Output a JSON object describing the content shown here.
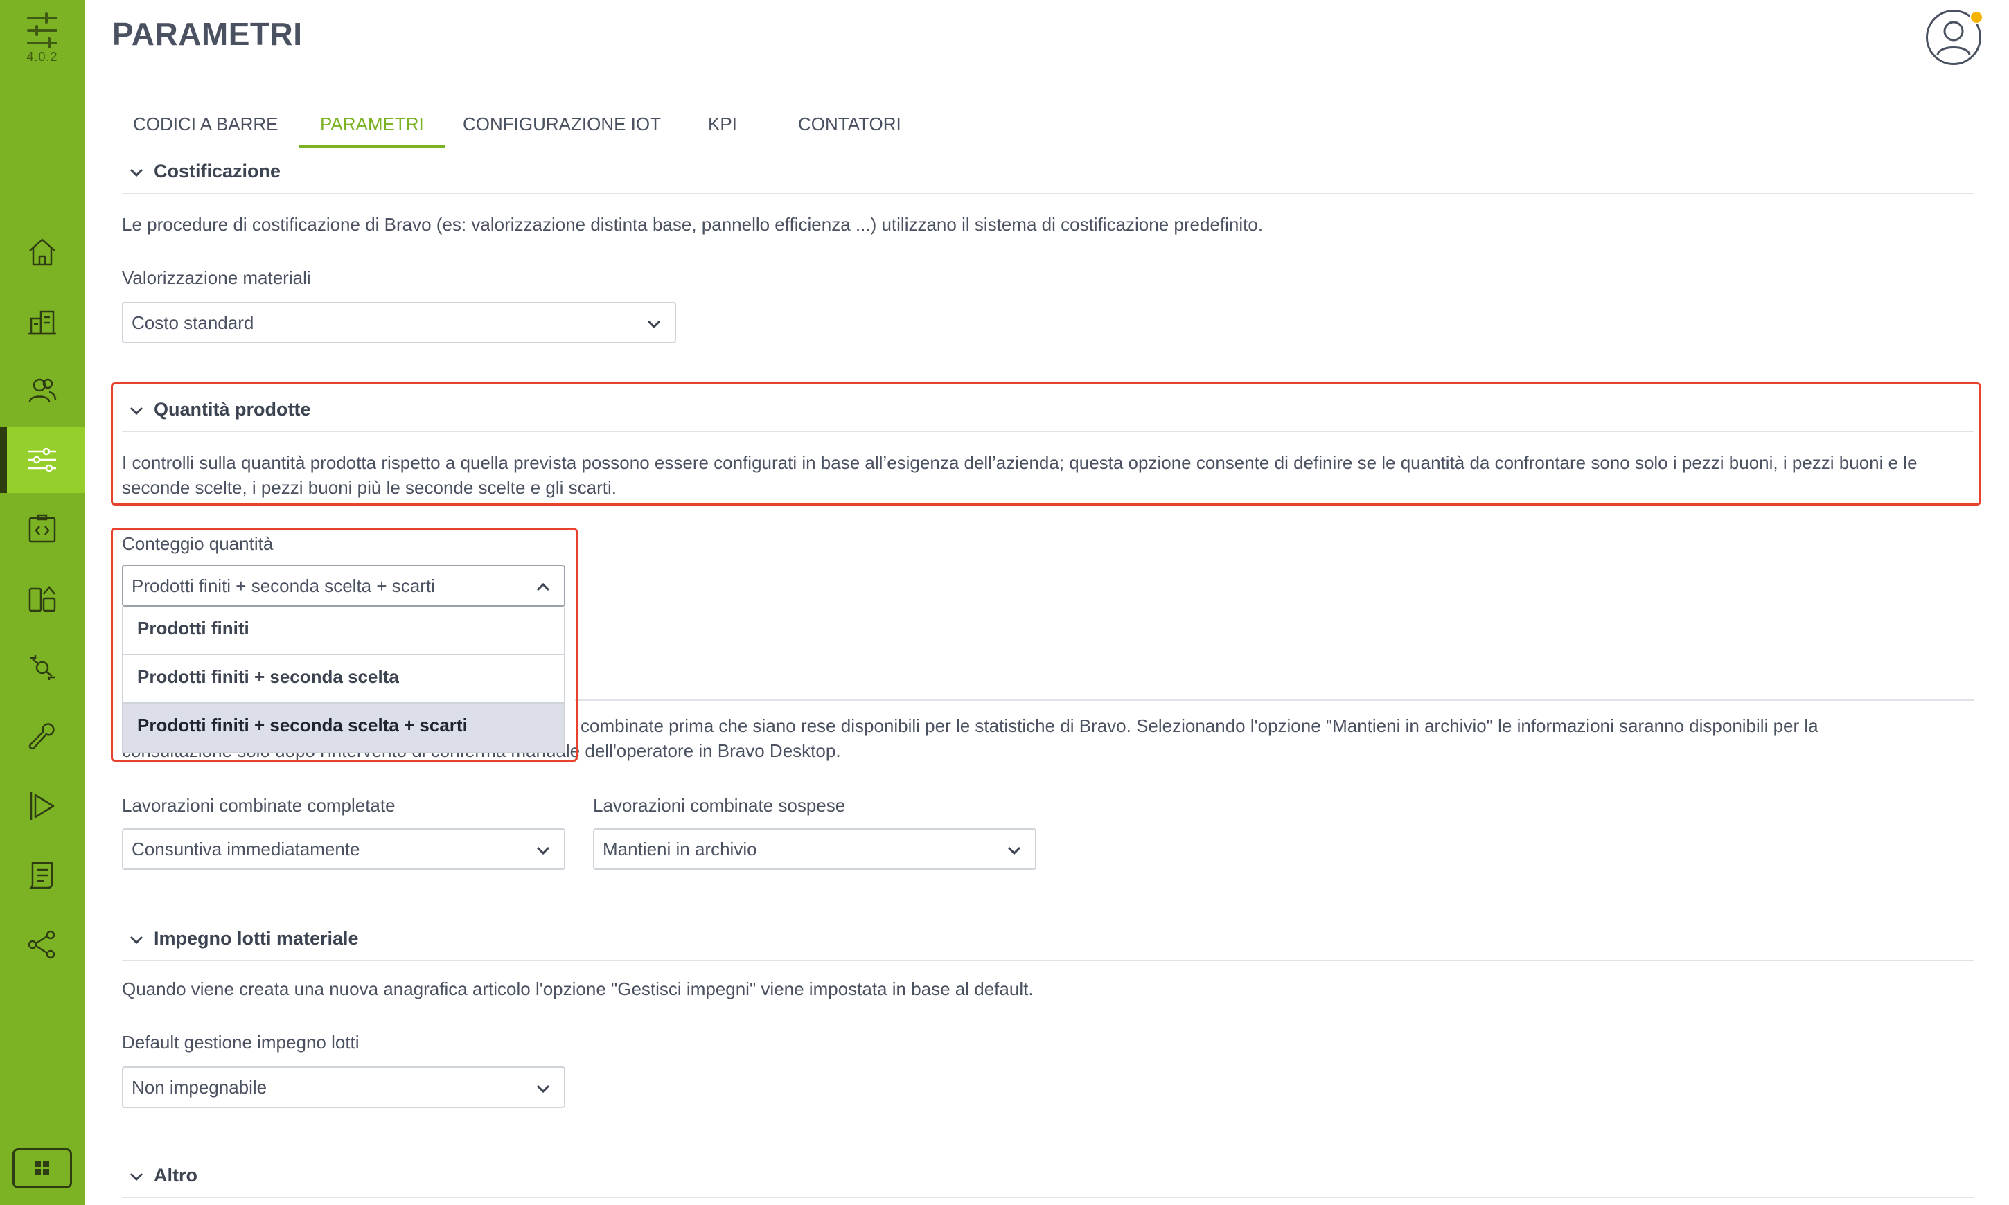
{
  "app": {
    "version": "4.0.2"
  },
  "header": {
    "title": "PARAMETRI"
  },
  "tabs": [
    {
      "label": "CODICI A BARRE",
      "active": false
    },
    {
      "label": "PARAMETRI",
      "active": true
    },
    {
      "label": "CONFIGURAZIONE IOT",
      "active": false
    },
    {
      "label": "KPI",
      "active": false
    },
    {
      "label": "CONTATORI",
      "active": false
    }
  ],
  "sidebar": {
    "items": [
      {
        "icon": "home-icon"
      },
      {
        "icon": "buildings-icon"
      },
      {
        "icon": "users-icon"
      },
      {
        "icon": "sliders-icon",
        "active": true
      },
      {
        "icon": "code-clipboard-icon"
      },
      {
        "icon": "devices-icon"
      },
      {
        "icon": "workflow-icon"
      },
      {
        "icon": "wrench-icon"
      },
      {
        "icon": "play-flag-icon"
      },
      {
        "icon": "document-icon"
      },
      {
        "icon": "share-icon"
      }
    ],
    "bottom_icon": "apps-grid-icon"
  },
  "sections": {
    "costificazione": {
      "title": "Costificazione",
      "description": "Le procedure di costificazione di Bravo (es: valorizzazione distinta base, pannello efficienza ...) utilizzano il sistema di costificazione predefinito.",
      "field_label": "Valorizzazione materiali",
      "field_value": "Costo standard"
    },
    "quantita": {
      "title": "Quantità prodotte",
      "description": "I controlli sulla quantità prodotta rispetto a quella prevista possono essere configurati in base all’esigenza dell’azienda; questa opzione consente di definire se le quantità da confrontare sono solo i pezzi buoni, i pezzi buoni e le seconde scelte, i pezzi buoni più le seconde scelte e gli scarti.",
      "field_label": "Conteggio quantità",
      "field_value": "Prodotti finiti + seconda scelta + scarti",
      "options": [
        "Prodotti finiti",
        "Prodotti finiti + seconda scelta",
        "Prodotti finiti + seconda scelta + scarti"
      ],
      "selected_index": 2
    },
    "lavorazioni": {
      "description_visible": "combinate prima che siano rese disponibili per le statistiche di Bravo. Selezionando l'opzione \"Mantieni in archivio\" le informazioni saranno disponibili per la",
      "description_line2": "consultazione solo dopo l'intervento di conferma manuale dell'operatore in Bravo Desktop.",
      "completed_label": "Lavorazioni combinate completate",
      "completed_value": "Consuntiva immediatamente",
      "suspended_label": "Lavorazioni combinate sospese",
      "suspended_value": "Mantieni in archivio"
    },
    "impegno": {
      "title": "Impegno lotti materiale",
      "description": "Quando viene creata una nuova anagrafica articolo l'opzione \"Gestisci impegni\" viene impostata in base al default.",
      "field_label": "Default gestione impegno lotti",
      "field_value": "Non impegnabile"
    },
    "altro": {
      "title": "Altro"
    }
  },
  "colors": {
    "sidebar": "#7cb324",
    "sidebar_active": "#94cf2c",
    "accent": "#7cb324",
    "highlight": "#e8412c",
    "selected_option": "#dcdfe8"
  }
}
